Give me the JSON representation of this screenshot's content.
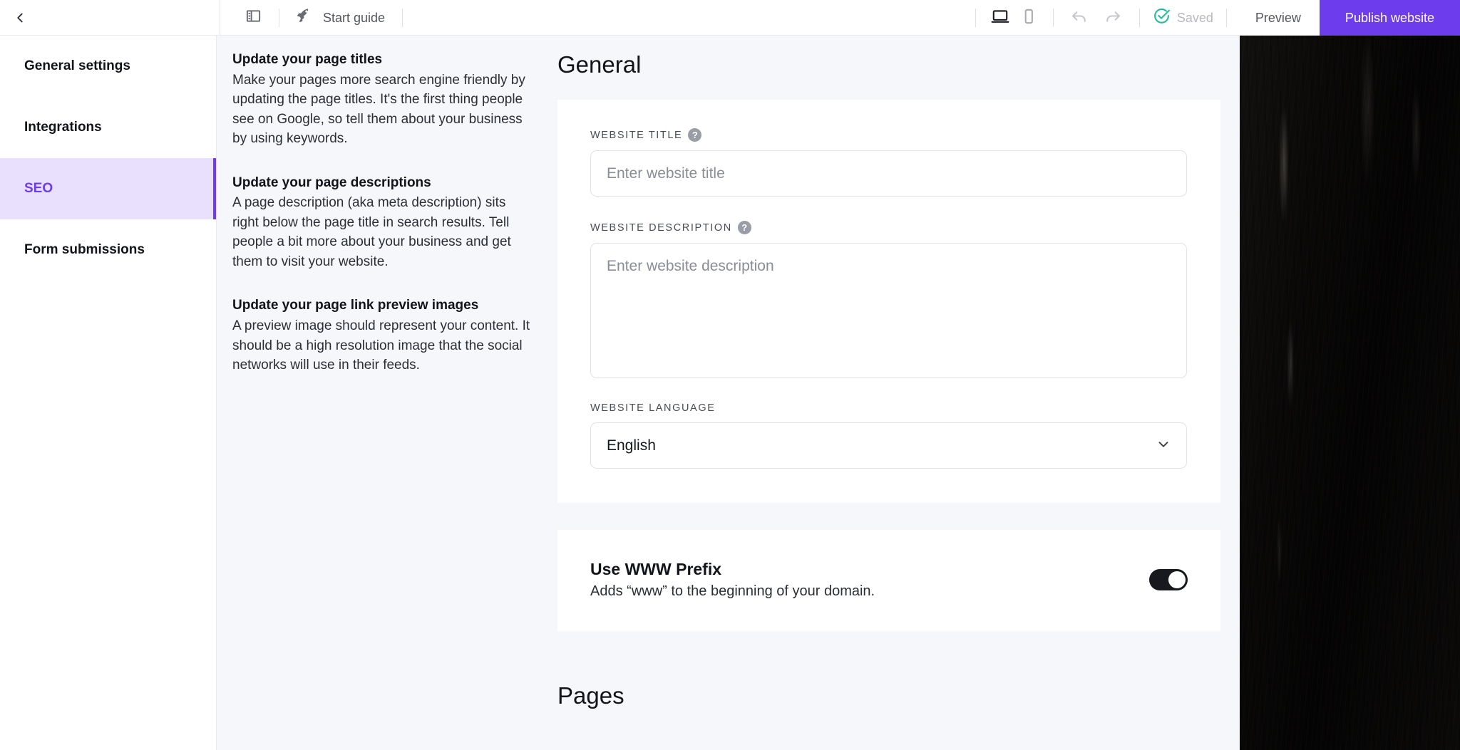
{
  "topbar": {
    "back_icon": "chevron-left-icon",
    "panel_toggle_icon": "sidebar-panel-icon",
    "guide_icon": "rocket-icon",
    "guide_label": "Start guide",
    "desktop_icon": "desktop-icon",
    "mobile_icon": "mobile-icon",
    "undo_icon": "undo-icon",
    "redo_icon": "redo-icon",
    "saved_icon": "check-circle-icon",
    "saved_label": "Saved",
    "preview_label": "Preview",
    "publish_label": "Publish website",
    "accent_color": "#6d3ded",
    "saved_color": "#1fbf9c"
  },
  "sidebar": {
    "items": [
      {
        "label": "General settings",
        "active": false
      },
      {
        "label": "Integrations",
        "active": false
      },
      {
        "label": "SEO",
        "active": true
      },
      {
        "label": "Form submissions",
        "active": false
      }
    ],
    "active_bg": "#e9e0fd",
    "active_color": "#6d3ded"
  },
  "tips": [
    {
      "title": "Update your page titles",
      "body": "Make your pages more search engine friendly by updating the page titles. It's the first thing people see on Google, so tell them about your business by using keywords."
    },
    {
      "title": "Update your page descriptions",
      "body": "A page description (aka meta description) sits right below the page title in search results. Tell people a bit more about your business and get them to visit your website."
    },
    {
      "title": "Update your page link preview images",
      "body": "A preview image should represent your content. It should be a high resolution image that the social networks will use in their feeds."
    }
  ],
  "main": {
    "heading": "General",
    "website_title": {
      "label": "WEBSITE TITLE",
      "help_icon": "question-mark-icon",
      "value": "",
      "placeholder": "Enter website title"
    },
    "website_description": {
      "label": "WEBSITE DESCRIPTION",
      "help_icon": "question-mark-icon",
      "value": "",
      "placeholder": "Enter website description"
    },
    "website_language": {
      "label": "WEBSITE LANGUAGE",
      "selected": "English",
      "chevron_icon": "chevron-down-icon",
      "options": [
        "English"
      ]
    },
    "www_prefix": {
      "title": "Use WWW Prefix",
      "description": "Adds “www” to the beginning of your domain.",
      "enabled": true
    },
    "pages_heading": "Pages"
  },
  "canvas_actions": [
    {
      "name": "settings-partial",
      "icon": "gear-icon",
      "disabled": false
    },
    {
      "name": "duplicate",
      "icon": "duplicate-icon",
      "disabled": false
    },
    {
      "name": "move-up",
      "icon": "arrow-up-icon",
      "disabled": true
    },
    {
      "name": "move-down",
      "icon": "arrow-down-icon",
      "disabled": false
    },
    {
      "name": "delete",
      "icon": "trash-icon",
      "disabled": false
    }
  ]
}
